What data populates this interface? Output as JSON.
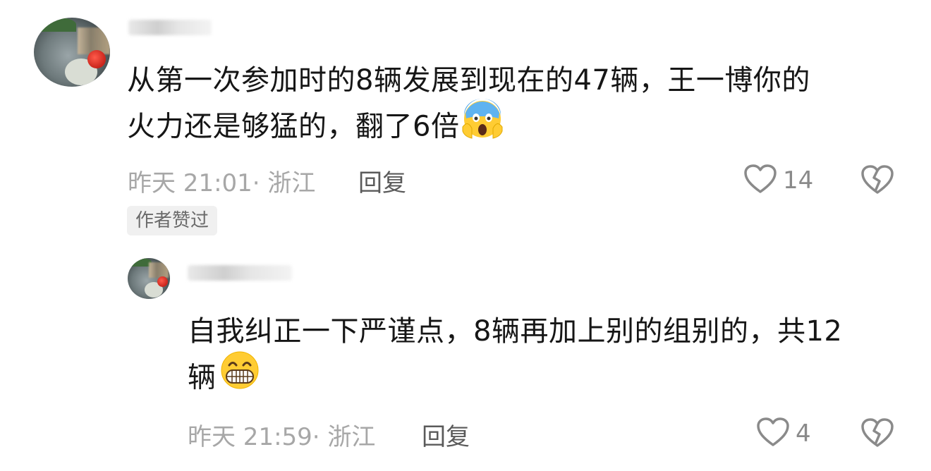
{
  "comments": [
    {
      "text_line1": "从第一次参加时的8辆发展到现在的47辆，王一博你的",
      "text_line2": "火力还是够猛的，翻了6倍",
      "emoji": "screaming-face-icon",
      "time": "昨天 21:01· 浙江",
      "reply_label": "回复",
      "likes": "14",
      "badge": "作者赞过"
    },
    {
      "text_line1": "自我纠正一下严谨点，8辆再加上别的组别的，共12",
      "text_line2": "辆",
      "emoji": "grinning-face-icon",
      "time": "昨天 21:59· 浙江",
      "reply_label": "回复",
      "likes": "4"
    }
  ],
  "colors": {
    "text": "#161616",
    "meta": "#a7a7a7",
    "reply": "#5a5a5a",
    "icon": "#8a8a8a",
    "badge_bg": "#f0f0f0"
  }
}
